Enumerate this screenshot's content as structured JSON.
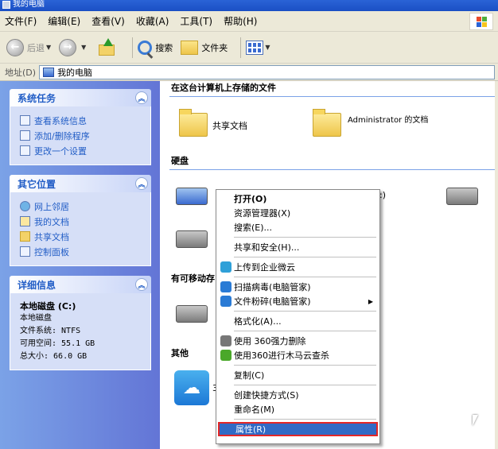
{
  "window": {
    "title": "我的电脑"
  },
  "menubar": [
    "文件(F)",
    "编辑(E)",
    "查看(V)",
    "收藏(A)",
    "工具(T)",
    "帮助(H)"
  ],
  "toolbar": {
    "back": "后退",
    "search": "搜索",
    "folders": "文件夹"
  },
  "address": {
    "label": "地址(D)",
    "value": "我的电脑"
  },
  "left": {
    "system_tasks": {
      "title": "系统任务",
      "items": [
        "查看系统信息",
        "添加/删除程序",
        "更改一个设置"
      ]
    },
    "other_places": {
      "title": "其它位置",
      "items": [
        "网上邻居",
        "我的文档",
        "共享文档",
        "控制面板"
      ]
    },
    "details": {
      "title": "详细信息",
      "name": "本地磁盘 (C:)",
      "type": "本地磁盘",
      "fs": "文件系统: NTFS",
      "free": "可用空间: 55.1 GB",
      "total": "总大小: 66.0 GB"
    }
  },
  "content": {
    "section_files": "在这台计算机上存储的文件",
    "shared_docs": "共享文档",
    "admin_docs": "Administrator 的文档",
    "section_disks": "硬盘",
    "section_removable": "有可移动存",
    "drive_partial": ":)",
    "section_other": "其他",
    "cloud_partial": "3"
  },
  "context_menu": {
    "items": [
      {
        "label": "打开(O)",
        "bold": true
      },
      {
        "label": "资源管理器(X)"
      },
      {
        "label": "搜索(E)..."
      },
      {
        "sep": true
      },
      {
        "label": "共享和安全(H)..."
      },
      {
        "sep": true
      },
      {
        "label": "上传到企业微云",
        "icon": "#2fa0d8"
      },
      {
        "sep": true
      },
      {
        "label": "扫描病毒(电脑管家)",
        "icon": "#2a7bd5"
      },
      {
        "label": "文件粉碎(电脑管家)",
        "icon": "#2a7bd5",
        "submenu": true
      },
      {
        "sep": true
      },
      {
        "label": "格式化(A)..."
      },
      {
        "sep": true
      },
      {
        "label": "使用 360强力删除",
        "icon": "#777"
      },
      {
        "label": "使用360进行木马云查杀",
        "icon": "#4aa82a"
      },
      {
        "sep": true
      },
      {
        "label": "复制(C)"
      },
      {
        "sep": true
      },
      {
        "label": "创建快捷方式(S)"
      },
      {
        "label": "重命名(M)"
      },
      {
        "sep": true
      },
      {
        "label": "属性(R)",
        "selected": true
      }
    ]
  }
}
